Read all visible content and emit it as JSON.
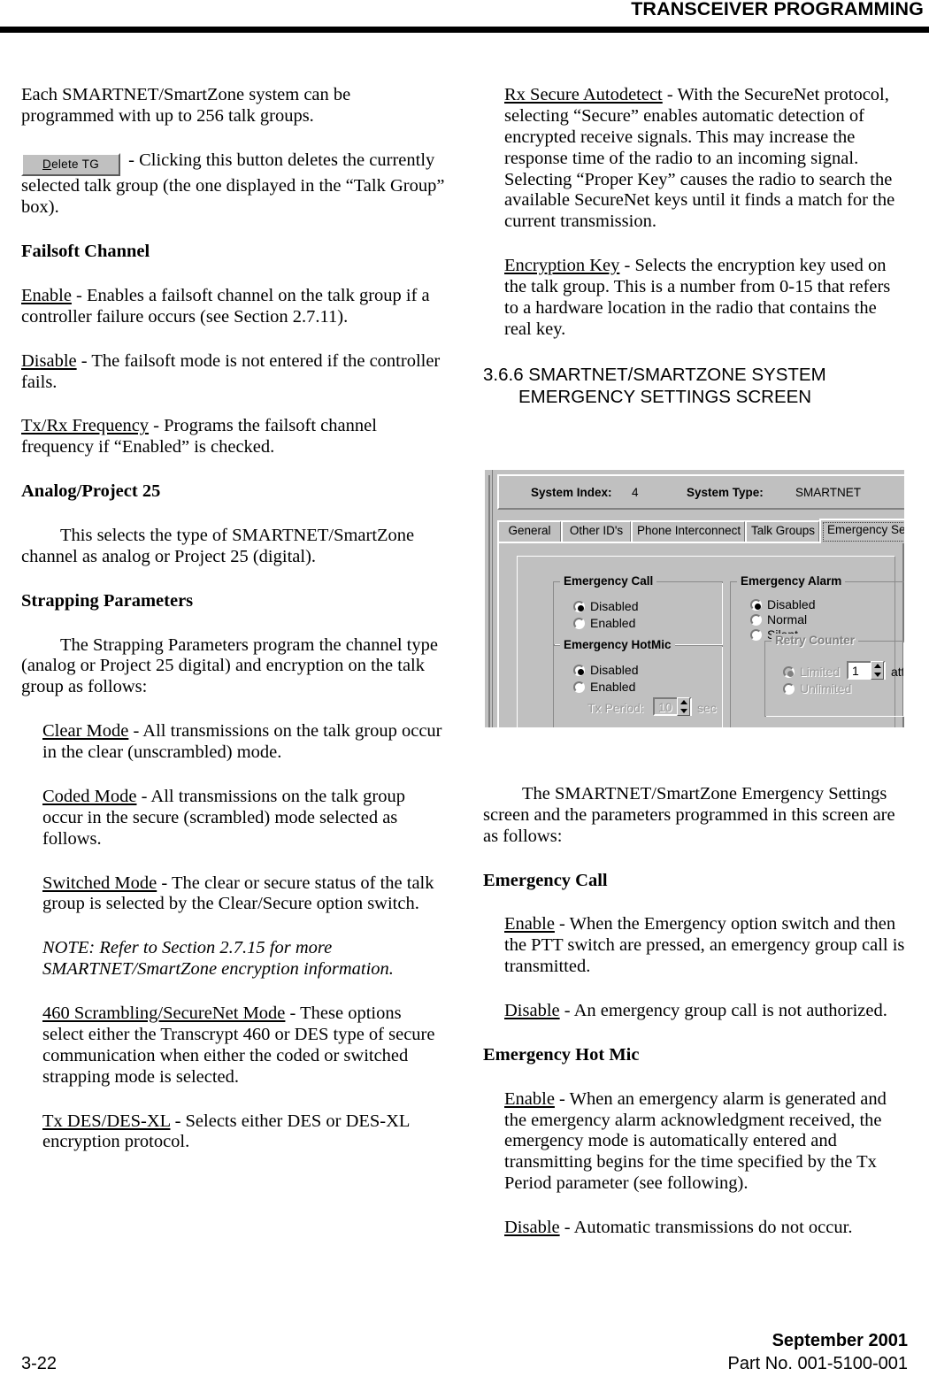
{
  "header": {
    "running_head": "TRANSCEIVER PROGRAMMING"
  },
  "footer": {
    "page_number": "3-22",
    "date": "September 2001",
    "part_number": "Part No. 001-5100-001"
  },
  "left_column": {
    "para_256_groups": "Each SMARTNET/SmartZone system can be programmed with up to 256 talk groups.",
    "delete_tg_button_label_pre": "D",
    "delete_tg_button_label_post": "elete TG",
    "delete_tg_desc": " - Clicking this button deletes the currently selected talk group (the one displayed in the “Talk Group” box).",
    "heading_failsoft": "Failsoft Channel",
    "failsoft_enable_term": "Enable",
    "failsoft_enable_desc": " - Enables a failsoft channel on the talk group if a controller failure occurs (see Section 2.7.11).",
    "failsoft_disable_term": "Disable",
    "failsoft_disable_desc": " - The failsoft mode is not entered if the controller fails.",
    "failsoft_txrx_term": "Tx/Rx Frequency",
    "failsoft_txrx_desc": " - Programs the failsoft channel frequency if “Enabled” is checked.",
    "heading_analog_p25": "Analog/Project 25",
    "para_analog_p25": "This selects the type of SMARTNET/SmartZone channel as analog or Project 25 (digital).",
    "heading_strapping": "Strapping Parameters",
    "para_strapping": "The Strapping Parameters program the channel type (analog or Project 25 digital) and encryption on the talk group as follows:",
    "clear_mode_term": "Clear Mode",
    "clear_mode_desc": " - All transmissions on the talk group occur in the clear (unscrambled) mode.",
    "coded_mode_term": "Coded Mode",
    "coded_mode_desc": " - All transmissions on the talk group occur in the secure (scrambled) mode selected as follows.",
    "switched_mode_term": "Switched Mode",
    "switched_mode_desc": " - The clear or secure status of the talk group is selected by the Clear/Secure option switch.",
    "note_text": "NOTE: Refer to Section 2.7.15 for more SMARTNET/SmartZone encryption information.",
    "scrambling_term": "460 Scrambling/SecureNet Mode",
    "scrambling_desc": " - These options select either the Transcrypt 460 or DES type of secure communication when either the coded or switched strapping mode is selected.",
    "tx_des_term": "Tx DES/DES-XL",
    "tx_des_desc": " - Selects either DES or DES-XL encryption protocol."
  },
  "right_column": {
    "rx_secure_term": "Rx Secure Autodetect",
    "rx_secure_desc": " - With the SecureNet protocol, selecting “Secure” enables automatic detection of encrypted receive signals. This may increase the response time of the radio to an incoming signal. Selecting “Proper Key” causes the radio to search the available SecureNet keys until it finds a match for the current transmission.",
    "encryption_key_term": "Encryption Key",
    "encryption_key_desc": " - Selects the encryption key used on the talk group. This is a number from 0-15 that refers to a hardware location in the radio that contains the real key.",
    "section_number": "3.6.6 SMARTNET/SMARTZONE SYSTEM",
    "section_title_line2": "EMERGENCY SETTINGS SCREEN",
    "para_intro": "The SMARTNET/SmartZone Emergency Settings screen and the parameters programmed in this screen are as follows:",
    "heading_emergency_call": "Emergency Call",
    "call_enable_term": "Enable",
    "call_enable_desc": " - When the Emergency option switch and then the PTT switch are pressed, an emergency group call is transmitted.",
    "call_disable_term": "Disable",
    "call_disable_desc": " - An emergency group call is not authorized.",
    "heading_emergency_hot_mic": "Emergency Hot Mic",
    "hotmic_enable_term": "Enable",
    "hotmic_enable_desc": " - When an emergency alarm is generated and the emergency alarm acknowledgment received, the emergency mode is automatically entered and transmitting begins for the time specified by the Tx Period parameter (see following).",
    "hotmic_disable_term": "Disable",
    "hotmic_disable_desc": " - Automatic transmissions do not occur."
  },
  "dialog": {
    "system_index_label": "System Index:",
    "system_index_value": "4",
    "system_type_label": "System Type:",
    "system_type_value": "SMARTNET",
    "tabs": [
      {
        "label": "General",
        "active": false
      },
      {
        "label": "Other ID's",
        "active": false
      },
      {
        "label": "Phone Interconnect",
        "active": false
      },
      {
        "label": "Talk Groups",
        "active": false
      },
      {
        "label": "Emergency Settings",
        "active": true
      }
    ],
    "emergency_call": {
      "title": "Emergency Call",
      "options": [
        {
          "label": "Disabled",
          "checked": true
        },
        {
          "label": "Enabled",
          "checked": false
        }
      ]
    },
    "emergency_hotmic": {
      "title": "Emergency HotMic",
      "options": [
        {
          "label": "Disabled",
          "checked": true
        },
        {
          "label": "Enabled",
          "checked": false
        }
      ],
      "tx_period_label": "Tx Period:",
      "tx_period_value": "10",
      "tx_period_unit": "sec"
    },
    "emergency_alarm": {
      "title": "Emergency Alarm",
      "options": [
        {
          "label": "Disabled",
          "checked": true
        },
        {
          "label": "Normal",
          "checked": false
        },
        {
          "label": "Silent",
          "checked": false
        }
      ],
      "retry_counter": {
        "title": "Retry Counter",
        "options": [
          {
            "label": "Limited",
            "checked": true
          },
          {
            "label": "Unlimited",
            "checked": false
          }
        ],
        "attempts_value": "1",
        "attempts_label": "attempts"
      }
    },
    "colors": {
      "face": "#c0c0c0",
      "shadow": "#808080",
      "highlight": "#ffffff",
      "disabled_text": "#9a9a9a"
    }
  }
}
